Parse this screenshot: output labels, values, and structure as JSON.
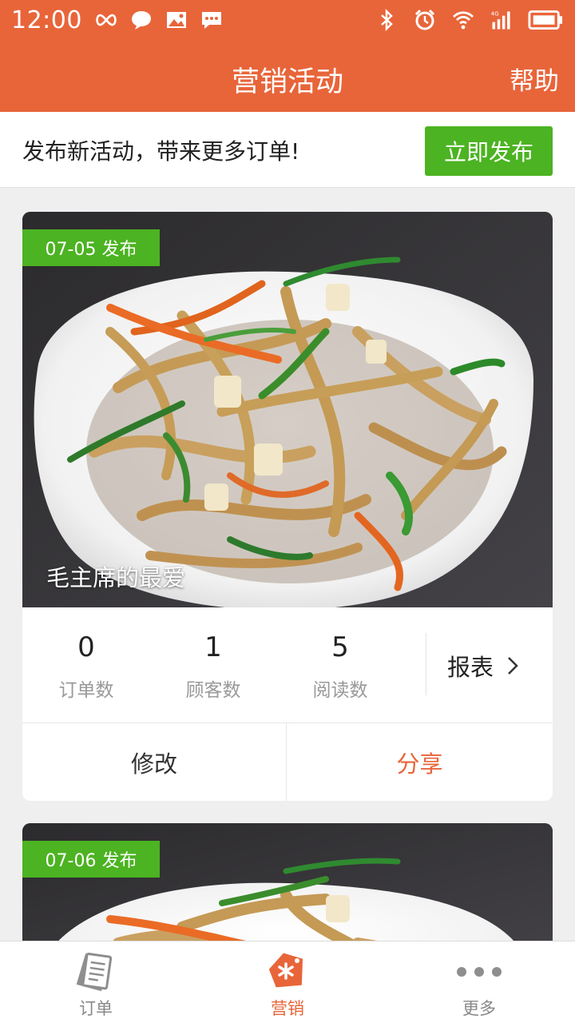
{
  "status_bar": {
    "time": "12:00",
    "left_icons": [
      "infinity-icon",
      "chat-bubble-icon",
      "image-icon",
      "message-icon"
    ],
    "right_icons": [
      "bluetooth-icon",
      "alarm-icon",
      "wifi-icon",
      "signal-4g-icon",
      "battery-icon"
    ],
    "network": "4G"
  },
  "header": {
    "title": "营销活动",
    "help_label": "帮助"
  },
  "banner": {
    "text": "发布新活动，带来更多订单!",
    "button_label": "立即发布"
  },
  "campaigns": [
    {
      "date_tag": "07-05 发布",
      "title": "毛主席的最爱",
      "stats": [
        {
          "value": "0",
          "label": "订单数"
        },
        {
          "value": "1",
          "label": "顾客数"
        },
        {
          "value": "5",
          "label": "阅读数"
        }
      ],
      "report_label": "报表",
      "edit_label": "修改",
      "share_label": "分享"
    },
    {
      "date_tag": "07-06 发布"
    }
  ],
  "bottom_nav": [
    {
      "label": "订单",
      "icon": "receipt-icon",
      "active": false
    },
    {
      "label": "营销",
      "icon": "tag-icon",
      "active": true
    },
    {
      "label": "更多",
      "icon": "more-dots-icon",
      "active": false
    }
  ],
  "colors": {
    "primary": "#e8653a",
    "green": "#4cb322",
    "text_gray": "#999999"
  }
}
